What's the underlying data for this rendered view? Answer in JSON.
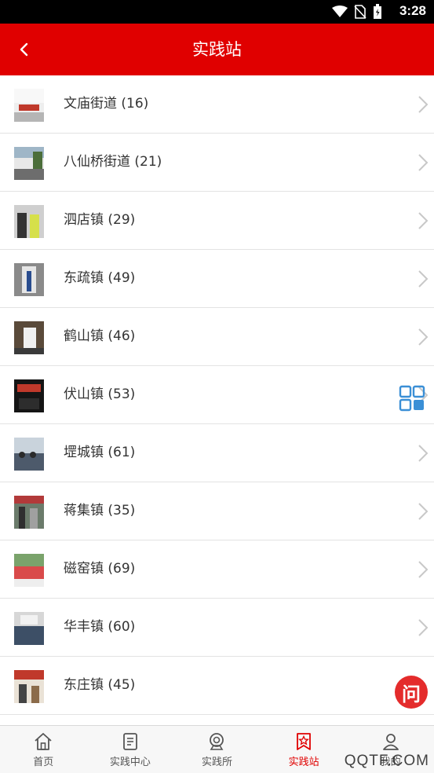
{
  "status_bar": {
    "time": "3:28"
  },
  "header": {
    "title": "实践站",
    "back_icon": "chevron-left-icon"
  },
  "stations": [
    {
      "label": "文庙街道 (16)"
    },
    {
      "label": "八仙桥街道 (21)"
    },
    {
      "label": "泗店镇 (29)"
    },
    {
      "label": "东疏镇 (49)"
    },
    {
      "label": "鹤山镇 (46)"
    },
    {
      "label": "伏山镇 (53)"
    },
    {
      "label": "堽城镇 (61)"
    },
    {
      "label": "蒋集镇 (35)"
    },
    {
      "label": "磁窑镇 (69)"
    },
    {
      "label": "华丰镇 (60)"
    },
    {
      "label": "东庄镇 (45)"
    }
  ],
  "float_buttons": {
    "ask_label": "问"
  },
  "tabs": [
    {
      "label": "首页",
      "icon": "home-icon"
    },
    {
      "label": "实践中心",
      "icon": "document-icon"
    },
    {
      "label": "实践所",
      "icon": "camera-icon"
    },
    {
      "label": "实践站",
      "icon": "star-flag-icon",
      "active": true
    },
    {
      "label": "我的",
      "icon": "user-icon"
    }
  ],
  "watermark": "QQTF.COM",
  "colors": {
    "brand_red": "#e00000",
    "accent_blue": "#3a8fd6"
  }
}
